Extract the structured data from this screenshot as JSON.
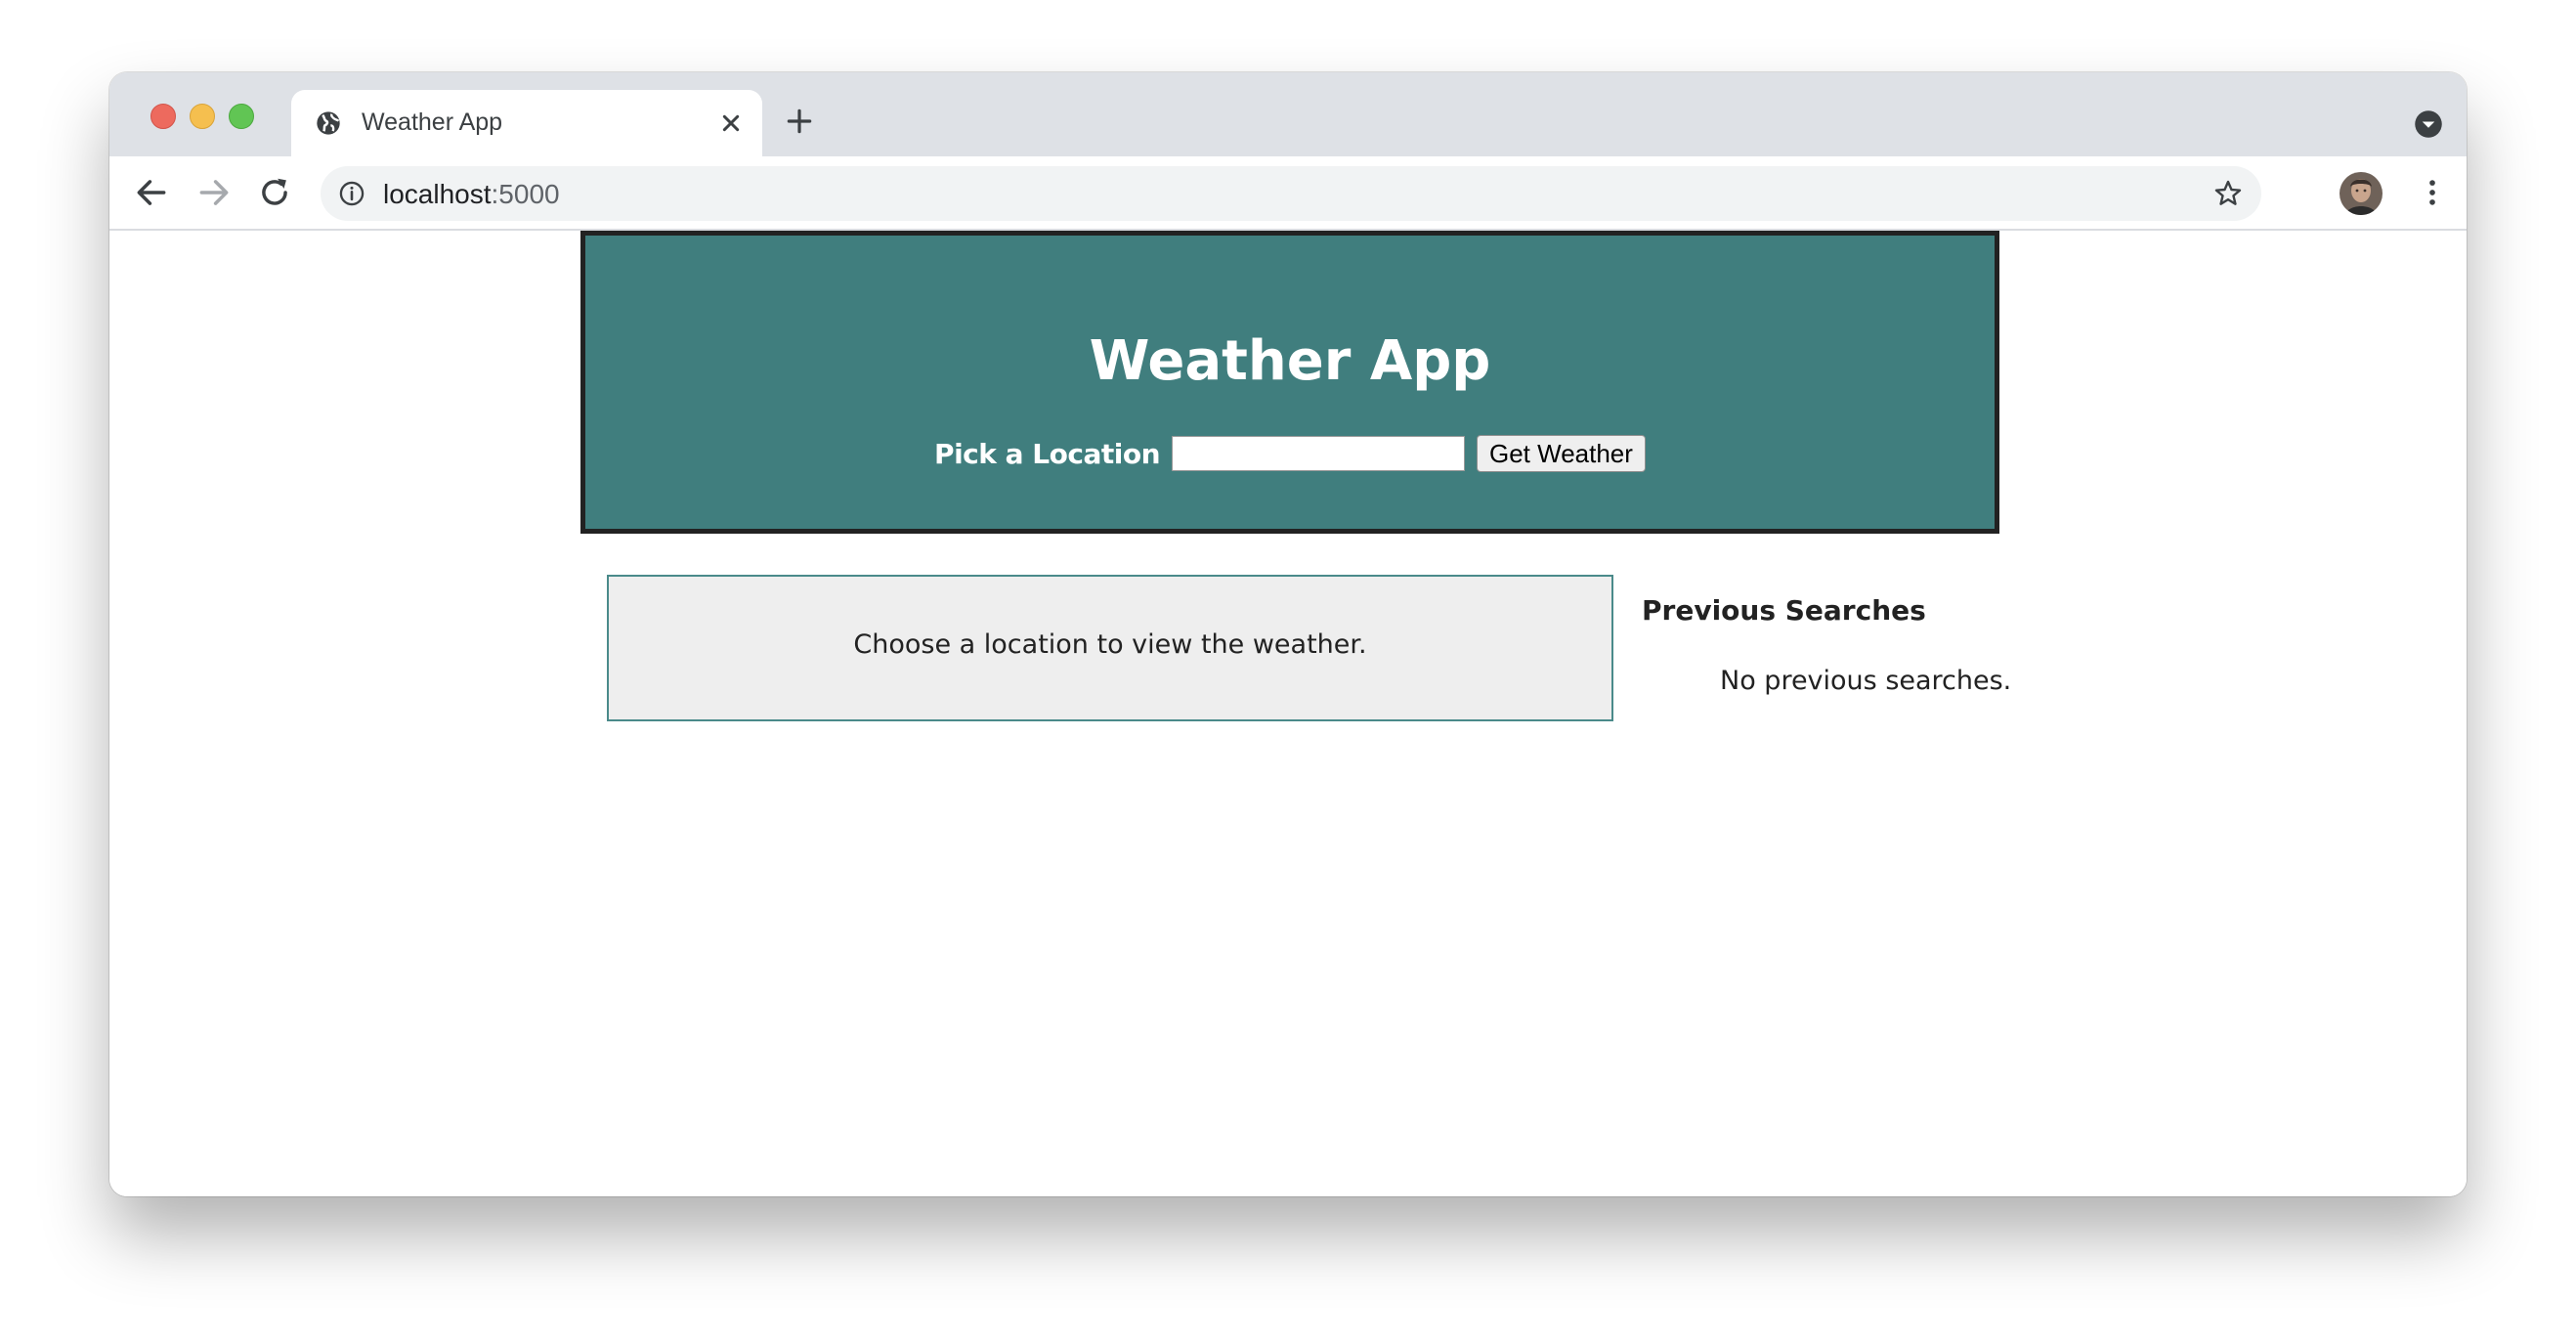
{
  "browser": {
    "tab_title": "Weather App",
    "url_host": "localhost",
    "url_port": ":5000",
    "icons": {
      "favicon": "globe-icon",
      "tab_close": "close-icon",
      "new_tab": "plus-icon",
      "tab_search": "chevron-down-circle-icon",
      "back": "arrow-left-icon",
      "forward": "arrow-right-icon",
      "reload": "reload-icon",
      "site_info": "info-icon",
      "bookmark": "star-icon",
      "profile": "avatar",
      "menu": "more-vert-icon"
    }
  },
  "app": {
    "title": "Weather App",
    "location_label": "Pick a Location",
    "location_value": "",
    "submit_label": "Get Weather",
    "weather_message": "Choose a location to view the weather.",
    "previous_searches_title": "Previous Searches",
    "previous_searches_empty": "No previous searches."
  },
  "colors": {
    "header_bg": "#407e7e",
    "header_border": "#222222",
    "weather_box_bg": "#eeeeee",
    "weather_box_border": "#4a8a8a"
  }
}
